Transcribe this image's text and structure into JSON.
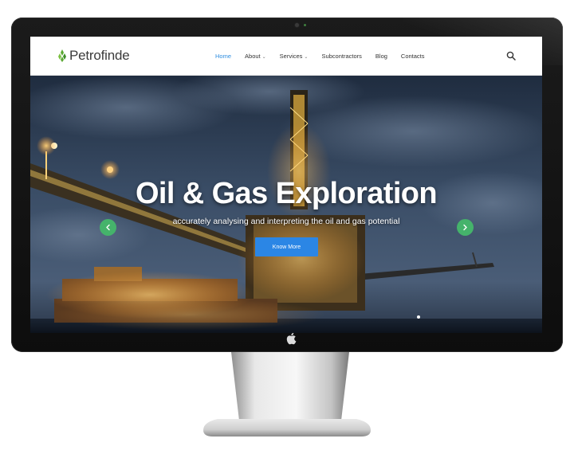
{
  "site": {
    "logo_text": "Petrofinde"
  },
  "nav": {
    "items": [
      {
        "label": "Home",
        "active": true,
        "has_dropdown": false
      },
      {
        "label": "About",
        "active": false,
        "has_dropdown": true
      },
      {
        "label": "Services",
        "active": false,
        "has_dropdown": true
      },
      {
        "label": "Subcontractors",
        "active": false,
        "has_dropdown": false
      },
      {
        "label": "Blog",
        "active": false,
        "has_dropdown": false
      },
      {
        "label": "Contacts",
        "active": false,
        "has_dropdown": false
      }
    ],
    "search_icon": "search-icon"
  },
  "hero": {
    "title": "Oil & Gas Exploration",
    "subtitle": "accurately analysing and interpreting the oil and gas potential",
    "button_label": "Know More",
    "prev_icon": "chevron-left-icon",
    "next_icon": "chevron-right-icon"
  },
  "colors": {
    "accent_blue": "#2b86e5",
    "nav_active": "#2f8ee0",
    "slider_arrow": "#45b36b",
    "logo_green": "#5aa832"
  }
}
